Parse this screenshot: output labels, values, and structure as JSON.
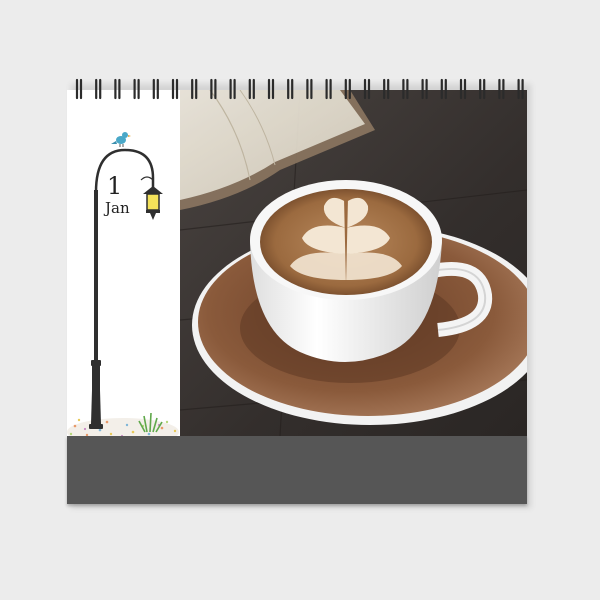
{
  "calendar": {
    "date": {
      "day": "1",
      "month": "Jan"
    },
    "photo": {
      "subject": "latte-art-coffee-cup"
    },
    "colors": {
      "base": "#565656",
      "page": "#ffffff",
      "coffee": "#8a5a3b",
      "table": "#3b3633",
      "bird": "#4aa8c8",
      "lamp_light": "#f4e25a"
    }
  }
}
